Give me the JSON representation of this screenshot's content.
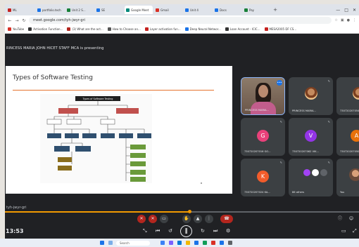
{
  "browser": {
    "tabs": [
      {
        "label": "ML",
        "color": "#c5221f"
      },
      {
        "label": "portfolio.tech",
        "color": "#1a73e8"
      },
      {
        "label": "Unit 2 S...",
        "color": "#188038"
      },
      {
        "label": "SE",
        "color": "#1a73e8"
      },
      {
        "label": "Google Meet",
        "color": "#00897b",
        "active": true
      },
      {
        "label": "Gmail",
        "color": "#d93025"
      },
      {
        "label": "Unit 4",
        "color": "#1a73e8"
      },
      {
        "label": "Docs",
        "color": "#1a73e8"
      },
      {
        "label": "Pay",
        "color": "#188038"
      }
    ],
    "new_tab_symbol": "+",
    "window_controls": [
      "—",
      "□",
      "✕"
    ],
    "url": "meet.google.com/tyh-jwyr-gri",
    "bookmarks": [
      {
        "label": "YouTube",
        "color": "#d93025"
      },
      {
        "label": "Activation Function...",
        "color": "#333333"
      },
      {
        "label": "(3) What are the act...",
        "color": "#b3261e"
      },
      {
        "label": "How to Choose an...",
        "color": "#555555"
      },
      {
        "label": "Layer activation fun...",
        "color": "#c5221f"
      },
      {
        "label": "Deep Neural Networ...",
        "color": "#1a73e8"
      },
      {
        "label": "Loan Account - ICIC...",
        "color": "#333333"
      },
      {
        "label": "MESA2005 DF CS...",
        "color": "#c5221f"
      }
    ]
  },
  "meet": {
    "presenting_text": "RINCESS MARIA JOHN HICET STAFF MCA is presenting",
    "slide": {
      "title": "Types of Software Testing",
      "diagram_title": "Types of Software Testing"
    },
    "participants": [
      {
        "name": "PRINCESS MARIA...",
        "type": "photo"
      },
      {
        "name": "730720207054 KA...",
        "type": "photo"
      },
      {
        "name": "730720207016 GO...",
        "initial": "G",
        "color": "#e8417a"
      },
      {
        "name": "730720207062 VIK...",
        "initial": "V",
        "color": "#9334e6"
      },
      {
        "name": "730720207050 KA...",
        "initial": "A",
        "color": "#e8710a"
      },
      {
        "name": "730720207024 KA...",
        "initial": "K",
        "color": "#f25c2b"
      },
      {
        "name": "86 others"
      },
      {
        "name": "You"
      }
    ],
    "host_name": "PRINCESS MARIA..."
  },
  "bottom": {
    "meeting_code": "tyh-jwyr-gri",
    "time": "13:53",
    "video_progress": 0.52
  },
  "taskbar": {
    "search_placeholder": "Search"
  }
}
